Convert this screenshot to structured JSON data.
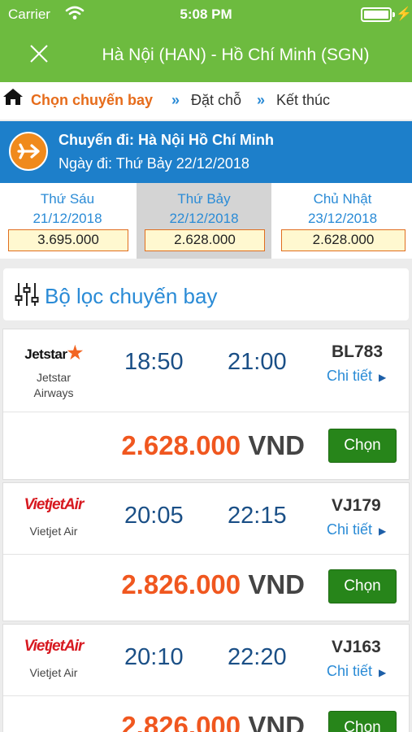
{
  "status_bar": {
    "carrier": "Carrier",
    "time": "5:08 PM"
  },
  "header": {
    "title": "Hà Nội (HAN) - Hồ Chí Minh (SGN)"
  },
  "breadcrumb": {
    "step1": "Chọn chuyến bay",
    "arrow": "»",
    "step2": "Đặt chỗ",
    "step3": "Kết thúc"
  },
  "trip": {
    "route": "Chuyến đi: Hà Nội Hồ Chí Minh",
    "date": "Ngày đi: Thứ Bảy 22/12/2018"
  },
  "days": [
    {
      "name": "Thứ Sáu",
      "date": "21/12/2018",
      "price": "3.695.000",
      "selected": false
    },
    {
      "name": "Thứ Bảy",
      "date": "22/12/2018",
      "price": "2.628.000",
      "selected": true
    },
    {
      "name": "Chủ Nhật",
      "date": "23/12/2018",
      "price": "2.628.000",
      "selected": false
    }
  ],
  "filter": {
    "label": "Bộ lọc chuyến bay"
  },
  "flights": [
    {
      "logo_text": "Jetstar",
      "airline": "Jetstar\nAirways",
      "depart": "18:50",
      "arrive": "21:00",
      "code": "BL783",
      "detail": "Chi tiết",
      "price": "2.628.000",
      "currency": "VND",
      "choose": "Chọn"
    },
    {
      "logo_text": "VietjetAir",
      "airline": "Vietjet Air",
      "depart": "20:05",
      "arrive": "22:15",
      "code": "VJ179",
      "detail": "Chi tiết",
      "price": "2.826.000",
      "currency": "VND",
      "choose": "Chọn"
    },
    {
      "logo_text": "VietjetAir",
      "airline": "Vietjet Air",
      "depart": "20:10",
      "arrive": "22:20",
      "code": "VJ163",
      "detail": "Chi tiết",
      "price": "2.826.000",
      "currency": "VND",
      "choose": "Chọn"
    }
  ],
  "colors": {
    "header": "#6dbb3f",
    "accent": "#e66c1b",
    "link": "#2a8bd6",
    "trip_bar": "#1d7fca",
    "choose_button": "#27851a",
    "price": "#f0571f"
  },
  "icons": {
    "close": "close-icon",
    "home": "home-icon",
    "plane": "plane-icon",
    "filter": "filter-sliders-icon",
    "wifi": "wifi-icon",
    "battery": "battery-icon",
    "detail": "triangle-right-icon"
  }
}
